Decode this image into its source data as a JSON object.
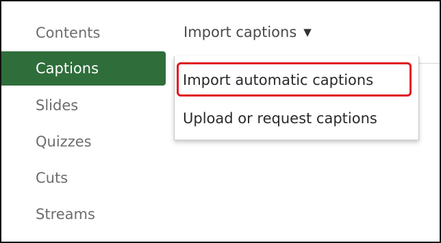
{
  "sidebar": {
    "items": [
      {
        "label": "Contents",
        "active": false
      },
      {
        "label": "Captions",
        "active": true
      },
      {
        "label": "Slides",
        "active": false
      },
      {
        "label": "Quizzes",
        "active": false
      },
      {
        "label": "Cuts",
        "active": false
      },
      {
        "label": "Streams",
        "active": false
      }
    ],
    "active_color": "#2f6e3b"
  },
  "import_menu": {
    "label": "Import captions",
    "caret_icon": "caret-down-icon",
    "options": [
      {
        "label": "Import automatic captions",
        "highlighted": true
      },
      {
        "label": "Upload or request captions",
        "highlighted": false
      }
    ],
    "highlight_color": "#e0141e"
  }
}
